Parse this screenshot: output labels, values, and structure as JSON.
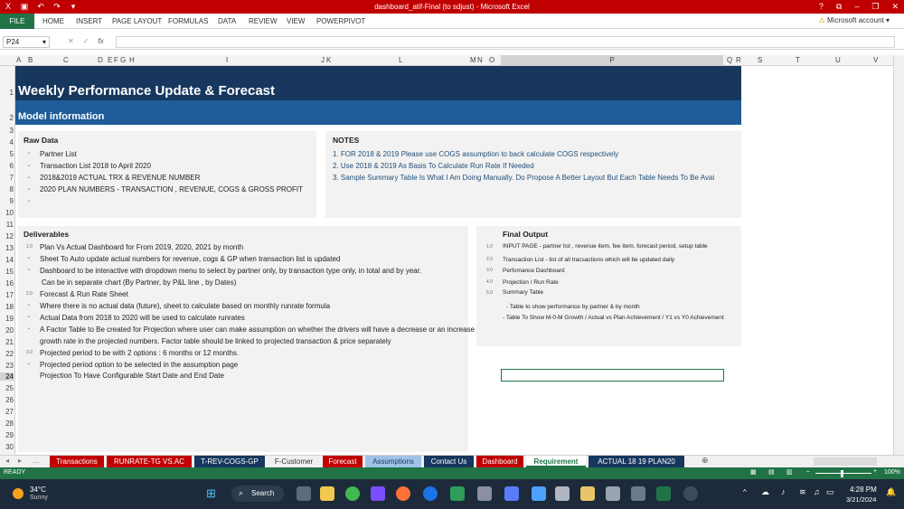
{
  "window": {
    "title": "dashboard_atif-Final (to sdjust) - Microsoft Excel",
    "controls": [
      "?",
      "⧉",
      "–",
      "❐",
      "✕"
    ]
  },
  "ribbon": {
    "file": "FILE",
    "tabs": [
      "HOME",
      "INSERT",
      "PAGE LAYOUT",
      "FORMULAS",
      "DATA",
      "REVIEW",
      "VIEW",
      "POWERPIVOT"
    ],
    "account": "Microsoft account"
  },
  "formula_bar": {
    "name_box": "P24",
    "fx": "fx",
    "value": ""
  },
  "columns": [
    "A",
    "B",
    "C",
    "D",
    "E",
    "F",
    "G",
    "H",
    "I",
    "J",
    "K",
    "L",
    "M",
    "N",
    "O",
    "P",
    "Q",
    "R",
    "S",
    "T",
    "U",
    "V"
  ],
  "rows": [
    "1",
    "2",
    "3",
    "4",
    "5",
    "6",
    "7",
    "8",
    "9",
    "10",
    "11",
    "12",
    "13",
    "14",
    "15",
    "16",
    "17",
    "18",
    "19",
    "20",
    "21",
    "22",
    "23",
    "24",
    "25",
    "26",
    "27",
    "28",
    "29",
    "30",
    "31"
  ],
  "sheet": {
    "title": "Weekly Performance Update & Forecast",
    "model_info": "Model information",
    "raw_data": {
      "heading": "Raw Data",
      "items": [
        "Partner List",
        "Transaction List 2018 to April 2020",
        "2018&2019 ACTUAL TRX & REVENUE NUMBER",
        "2020 PLAN NUMBERS - TRANSACTION , REVENUE, COGS & GROSS PROFIT"
      ]
    },
    "notes": {
      "heading": "NOTES",
      "items": [
        "1. FOR 2018 & 2019 Please use COGS assumption to back calculate COGS respectively",
        "2. Use 2018 & 2019 As Basis To Calculate Run Rate If Needed",
        "3. Sample Summary Table Is What I Am Doing Manually. Do Propose A Better Layout But Each Table Needs To Be Avai"
      ]
    },
    "deliverables": {
      "heading": "Deliverables",
      "numbers": [
        "1.0",
        "2.0",
        "3.0"
      ],
      "items": [
        "Plan Vs Actual Dashboard for From 2019, 2020, 2021 by month",
        "Sheet To Auto update actual numbers for revenue, cogs & GP when transaction list is updated",
        "Dashboard to be interactive with dropdown menu to select by partner only, by transaction type only, in total and by year.",
        "Can be in separate chart (By Partner, by P&L line , by Dates)",
        "Forecast & Run Rate Sheet",
        "Where there is no actual data (future), sheet to calculate based on monthly runrate formula",
        "Actual Data from 2018 to 2020 will be used to calculate runrates",
        "A Factor Table to Be created for Projection where user can make assumption on whether the drivers will have a decrease or an increase",
        "growth rate in the projected numbers. Factor table should be linked to projected transaction & price separately",
        "Projected period to be with 2 options : 6 months or 12 months.",
        "Projected period option to be selected in the assumption page",
        "Projection To Have Configurable Start Date and End Date"
      ]
    },
    "final_output": {
      "heading": "Final Output",
      "numbers": [
        "1.0",
        "2.0",
        "3.0",
        "4.0",
        "5.0"
      ],
      "items": [
        "INPUT PAGE - partner list , revenue item, fee item, forecast period, setup table",
        "Transaction List - list of all tracsactions which will be updated daily",
        "Perfomance Dashboard",
        "Projection / Run Rate",
        "Summary Table",
        "- Table to show performance by partner & by month",
        "- Table To Show M-0-M Growth / Actual vs Plan Achievement / Y1 vs Y0 Achievement"
      ]
    }
  },
  "sheet_tabs": [
    {
      "label": "Transactions",
      "color": "#c00000"
    },
    {
      "label": "RUNRATE-TG VS.AC",
      "color": "#c00000"
    },
    {
      "label": "T-REV-COGS-GP",
      "color": "#17375e"
    },
    {
      "label": "F-Customer",
      "color": "#f0f0f0"
    },
    {
      "label": "Forecast",
      "color": "#c00000"
    },
    {
      "label": "Assumptions",
      "color": "#9dc3e6"
    },
    {
      "label": "Contact Us",
      "color": "#17375e"
    },
    {
      "label": "Dashboard",
      "color": "#c00000"
    },
    {
      "label": "Requirement",
      "color": "#ffffff"
    },
    {
      "label": "ACTUAL 18 19 PLAN20",
      "color": "#17375e"
    }
  ],
  "status": {
    "ready": "READY",
    "zoom": "100%"
  },
  "taskbar": {
    "temp": "34°C",
    "weather": "Sunny",
    "search": "Search",
    "time": "4:28 PM",
    "date": "3/21/2024"
  }
}
